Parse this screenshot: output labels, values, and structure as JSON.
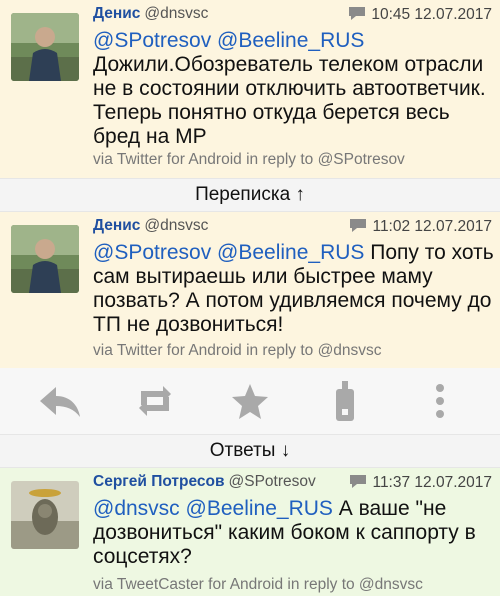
{
  "tweets": [
    {
      "author": "Денис",
      "handle": "@dnsvsc",
      "timestamp": "10:45 12.07.2017",
      "mentions": "@SPotresov @Beeline_RUS",
      "body": "Дожили.Обозреватель телеком отрасли не в состоянии отключить автоответчик. Теперь понятно откуда берется весь бред на МР",
      "via": "via Twitter for Android in reply to @SPotresov"
    },
    {
      "author": "Денис",
      "handle": "@dnsvsc",
      "timestamp": "11:02 12.07.2017",
      "mentions": "@SPotresov @Beeline_RUS",
      "body": " Попу то хоть сам вытираешь или быстрее маму позвать? А потом удивляемся почему до ТП не дозвониться!",
      "via": "via Twitter for Android in reply to @dnsvsc"
    },
    {
      "author": "Сергей Потресов",
      "handle": "@SPotresov",
      "timestamp": "11:37 12.07.2017",
      "mentions": "@dnsvsc @Beeline_RUS",
      "body": " А ваше \"не дозвониться\" каким боком к саппорту в соцсетях?",
      "via": "via TweetCaster for Android in reply to @dnsvsc"
    }
  ],
  "dividers": {
    "thread": "Переписка ↑",
    "replies": "Ответы ↓"
  },
  "actions": [
    "reply-icon",
    "retweet-icon",
    "favorite-star-icon",
    "share-phone-icon",
    "more-vert-icon"
  ],
  "colors": {
    "mention": "#1f5fbf",
    "author": "#1f4fa0",
    "tweet_bg": "#fdf5df",
    "reply_bg": "#eef8e2",
    "icon": "#a9a9a9"
  }
}
